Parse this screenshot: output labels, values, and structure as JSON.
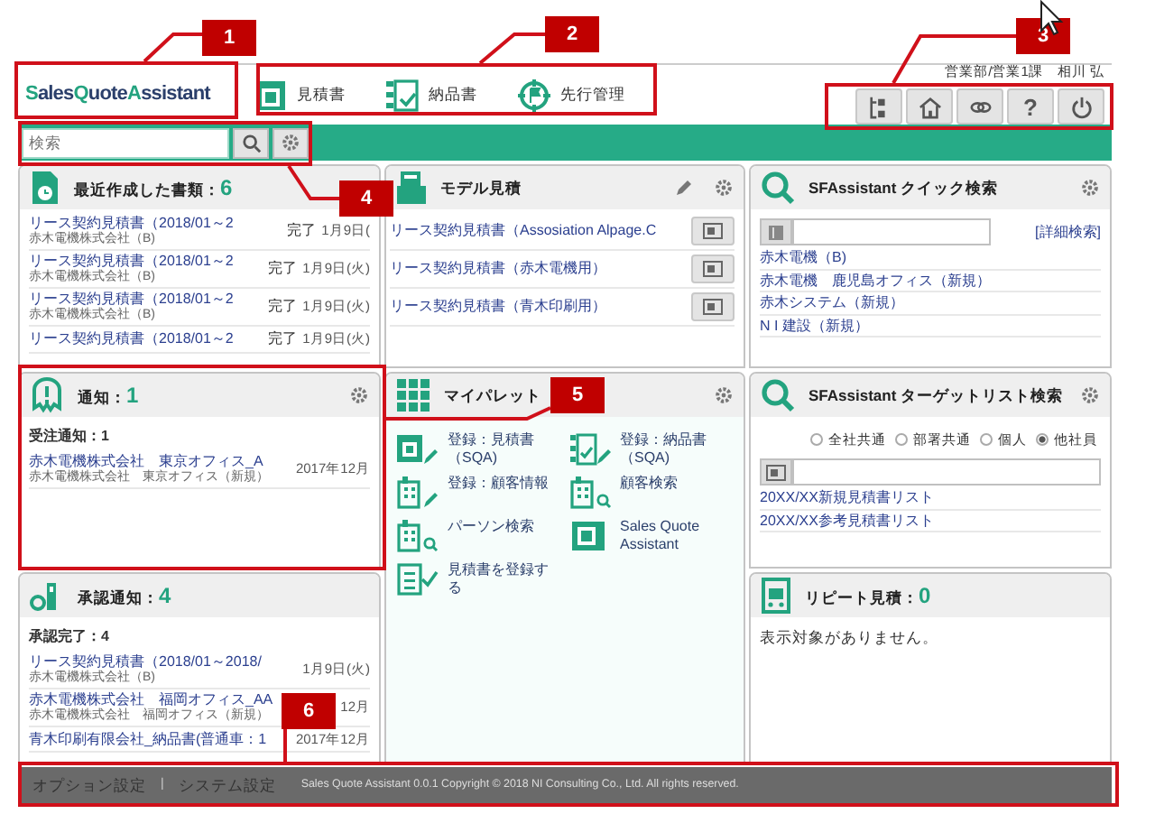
{
  "header": {
    "logo": [
      "Sales",
      "Quote",
      "Assistant"
    ],
    "nav": [
      {
        "label": "見積書"
      },
      {
        "label": "納品書"
      },
      {
        "label": "先行管理"
      }
    ],
    "user": "営業部/営業1課　相川 弘",
    "tools": [
      {
        "kind": "tree"
      },
      {
        "kind": "home"
      },
      {
        "kind": "link"
      },
      {
        "kind": "help",
        "glyph": "?"
      },
      {
        "kind": "power"
      }
    ]
  },
  "search": {
    "placeholder": "検索"
  },
  "panels": [
    {
      "kind": "docs",
      "title": "最近作成した書類：",
      "count": "6",
      "items": [
        {
          "title": "リース契約見積書（2018/01～2",
          "sub": "赤木電機株式会社（B)",
          "status": "完了",
          "date": "1月9日("
        },
        {
          "title": "リース契約見積書（2018/01～2",
          "sub": "赤木電機株式会社（B)",
          "status": "完了",
          "date": "1月9日(火)"
        },
        {
          "title": "リース契約見積書（2018/01～2",
          "sub": "赤木電機株式会社（B)",
          "status": "完了",
          "date": "1月9日(火)"
        },
        {
          "title": "リース契約見積書（2018/01～2",
          "status": "完了",
          "date": "1月9日(火)"
        }
      ]
    },
    {
      "kind": "models",
      "title": "モデル見積",
      "pencil": true,
      "gear": true,
      "items": [
        {
          "title": "リース契約見積書（Assosiation Alpage.C"
        },
        {
          "title": "リース契約見積書（赤木電機用）"
        },
        {
          "title": "リース契約見積書（青木印刷用）"
        }
      ]
    },
    {
      "kind": "quick",
      "title": "SFAssistant クイック検索",
      "gear": true,
      "detail_link": "[詳細検索]",
      "items": [
        {
          "title": "赤木電機（B)"
        },
        {
          "title": "赤木電機　鹿児島オフィス（新規）"
        },
        {
          "title": "赤木システム（新規）"
        },
        {
          "title": "N I 建設（新規）"
        }
      ]
    },
    {
      "kind": "notice",
      "title": "通知：",
      "count": "1",
      "gear": true,
      "section": "受注通知：1",
      "items": [
        {
          "title": "赤木電機株式会社　東京オフィス_A",
          "sub": "赤木電機株式会社　東京オフィス（新規）",
          "date": "2017年12月"
        }
      ]
    },
    {
      "kind": "palette",
      "title": "マイパレット",
      "gear": true,
      "items": [
        {
          "label": "登録：見積書（SQA)"
        },
        {
          "label": "登録：納品書（SQA)"
        },
        {
          "label": "登録：顧客情報"
        },
        {
          "label": "顧客検索"
        },
        {
          "label": "パーソン検索"
        },
        {
          "label": "Sales Quote Assistant"
        },
        {
          "label": "見積書を登録する"
        }
      ]
    },
    {
      "kind": "target",
      "title": "SFAssistant ターゲットリスト検索",
      "gear": true,
      "radios": [
        {
          "label": "全社共通",
          "selected": false
        },
        {
          "label": "部署共通",
          "selected": false
        },
        {
          "label": "個人",
          "selected": false
        },
        {
          "label": "他社員",
          "selected": true
        }
      ],
      "items": [
        {
          "title": "20XX/XX新規見積書リスト"
        },
        {
          "title": "20XX/XX参考見積書リスト"
        }
      ]
    },
    {
      "kind": "approval",
      "title": "承認通知：",
      "count": "4",
      "section": "承認完了：4",
      "items": [
        {
          "title": "リース契約見積書（2018/01～2018/",
          "sub": "赤木電機株式会社（B)",
          "date": "1月9日(火)"
        },
        {
          "title": "赤木電機株式会社　福岡オフィス_AA",
          "sub": "赤木電機株式会社　福岡オフィス（新規）",
          "date": "12月"
        },
        {
          "title": "青木印刷有限会社_納品書(普通車：1",
          "date": "2017年12月"
        }
      ]
    },
    {
      "kind": "empty",
      "title": "リピート見積：",
      "count": "0",
      "message": "表示対象がありません。"
    }
  ],
  "footer": {
    "links": [
      "オプション設定",
      "システム設定"
    ],
    "separator": "|",
    "copyright": "Sales Quote Assistant 0.0.1 Copyright © 2018 NI Consulting Co., Ltd. All rights reserved."
  },
  "callouts": [
    {
      "number": "1"
    },
    {
      "number": "2"
    },
    {
      "number": "3"
    },
    {
      "number": "4"
    },
    {
      "number": "5"
    },
    {
      "number": "6"
    }
  ]
}
